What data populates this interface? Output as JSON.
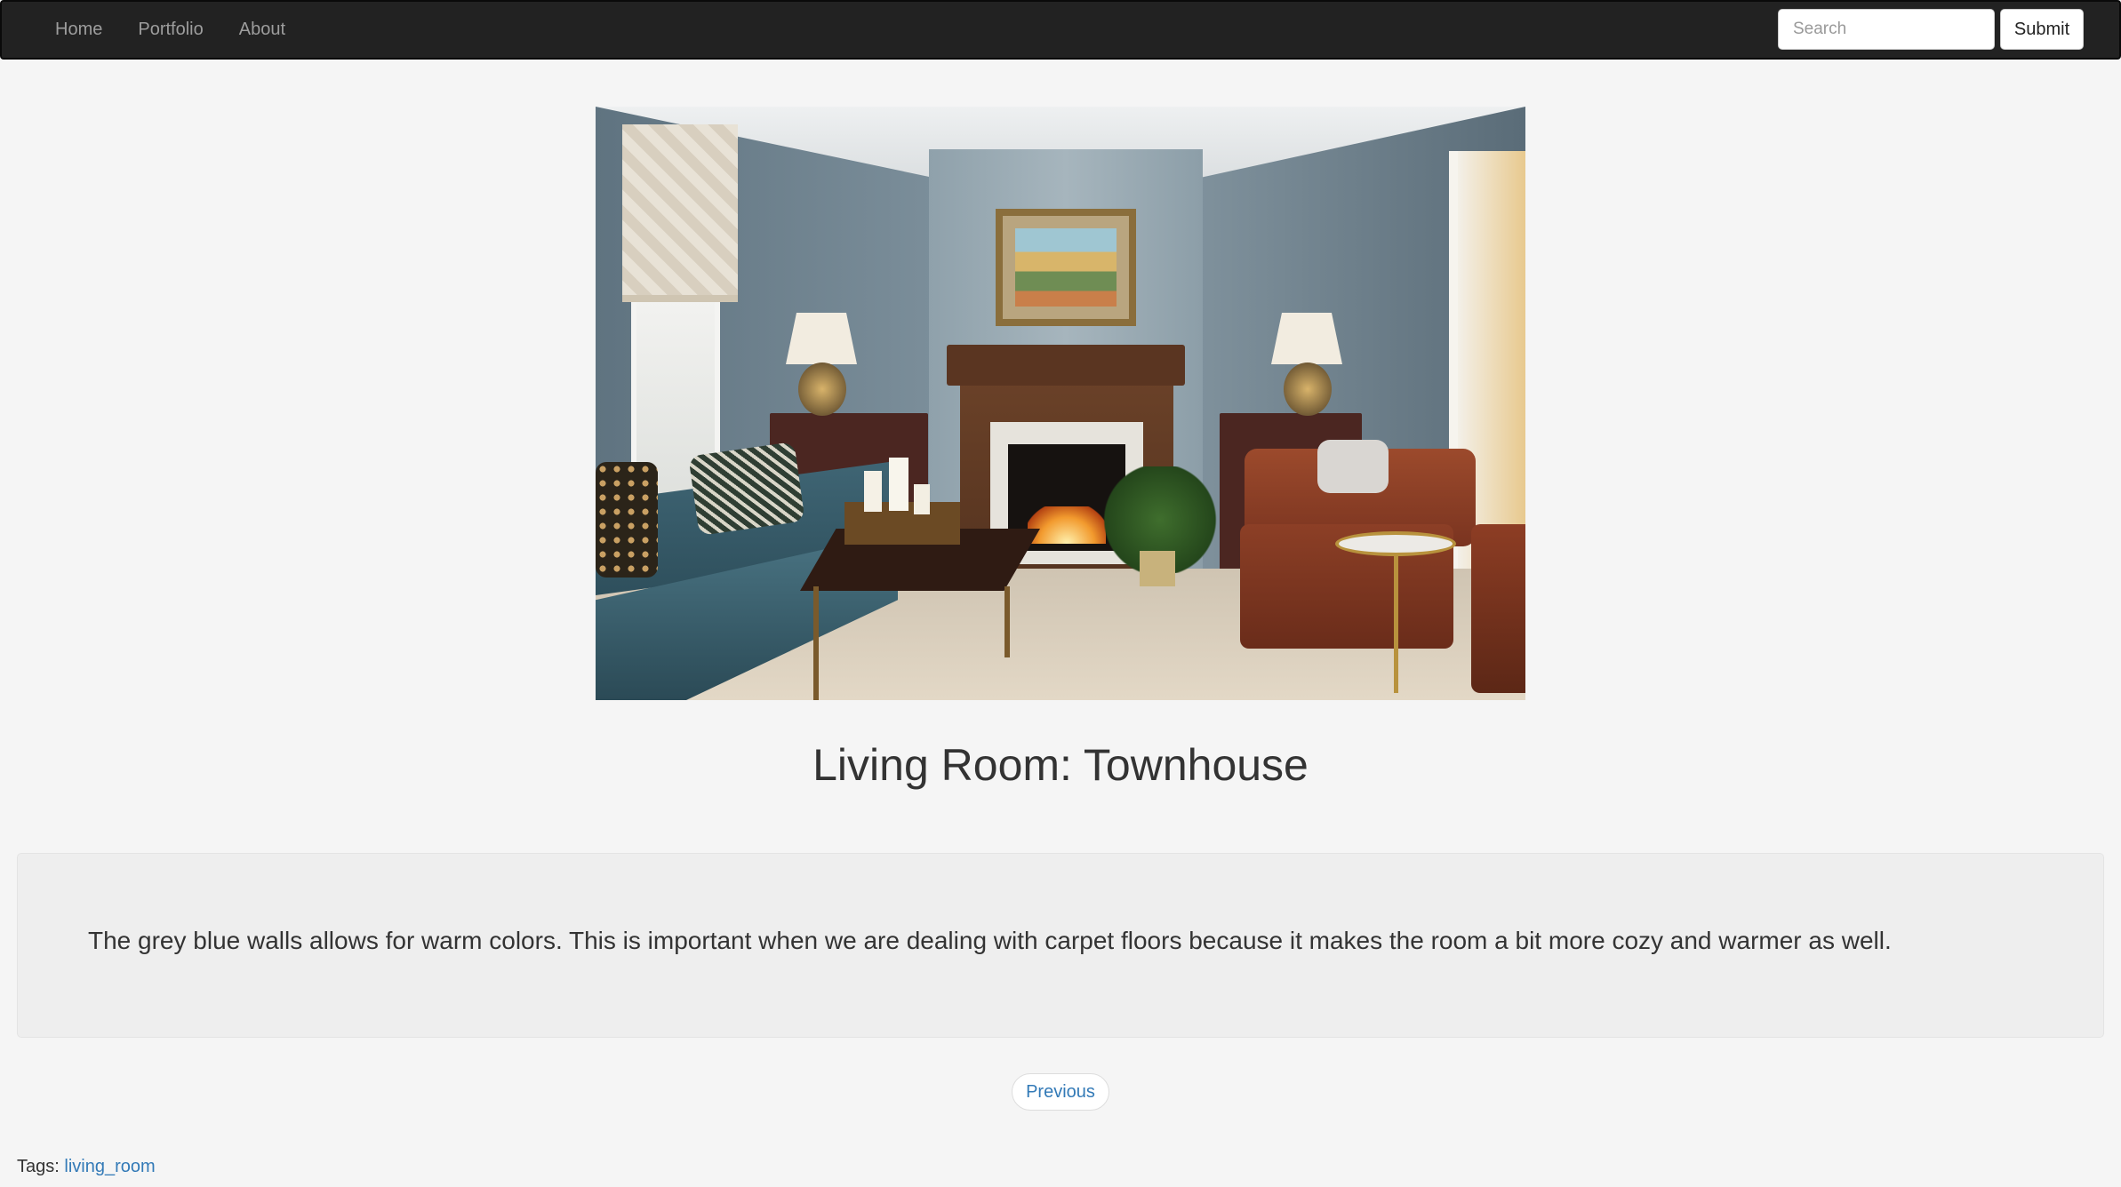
{
  "navbar": {
    "links": [
      {
        "label": "Home"
      },
      {
        "label": "Portfolio"
      },
      {
        "label": "About"
      }
    ],
    "search": {
      "placeholder": "Search",
      "value": "",
      "submit_label": "Submit"
    }
  },
  "main": {
    "title": "Living Room: Townhouse",
    "description": "The grey blue walls allows for warm colors. This is important when we are dealing with carpet floors because it makes the room a bit more cozy and warmer as well.",
    "pager": {
      "previous_label": "Previous"
    },
    "tags": {
      "label": "Tags:",
      "items": [
        "living_room"
      ]
    }
  },
  "colors": {
    "navbar_bg": "#222222",
    "page_bg": "#f5f5f5",
    "well_bg": "#eeeeee",
    "link": "#337ab7"
  }
}
